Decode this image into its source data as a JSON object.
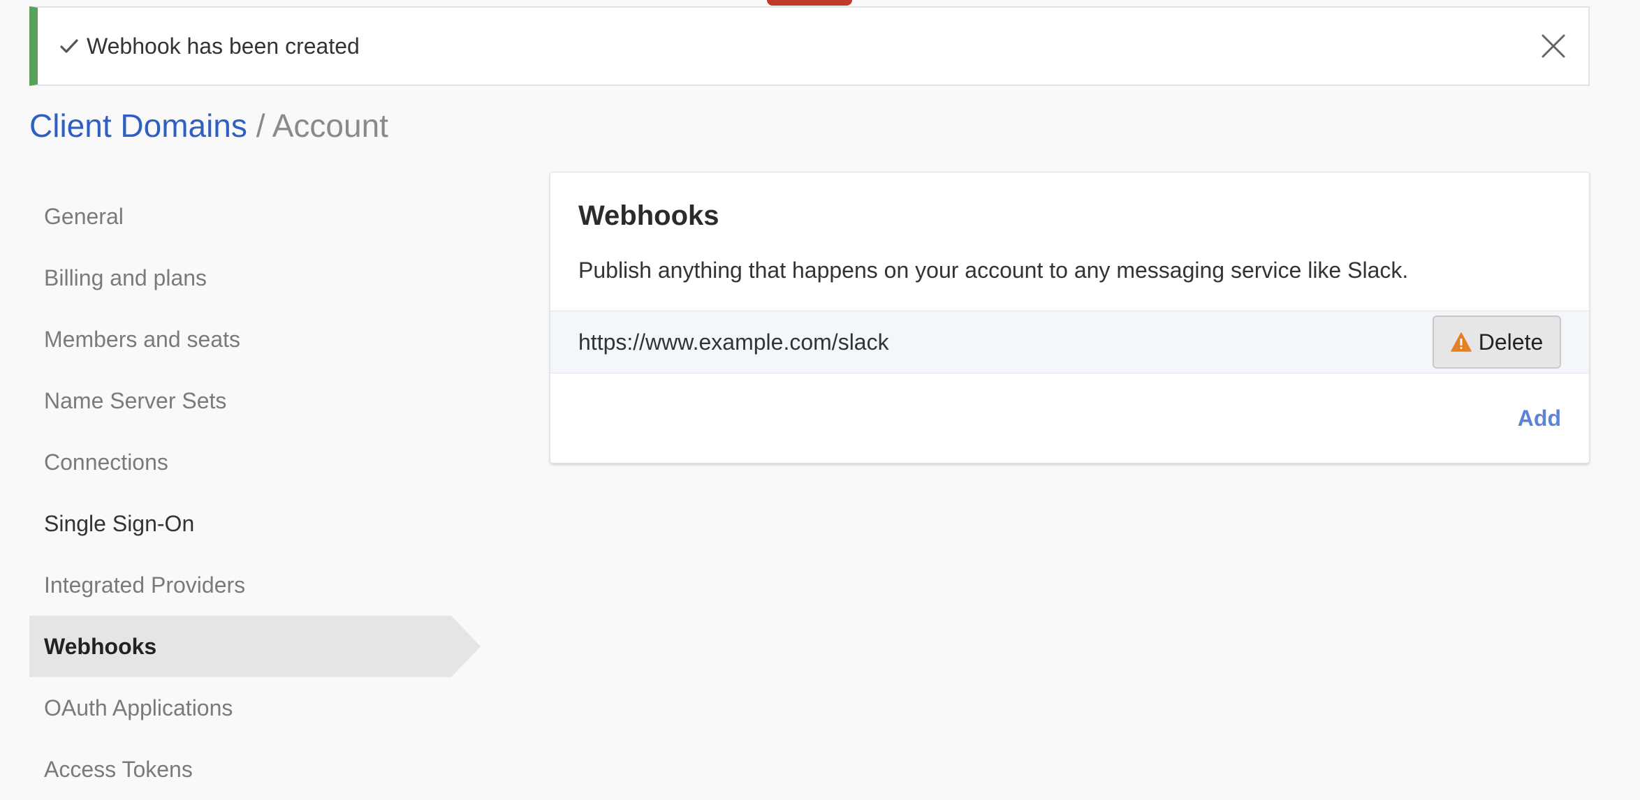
{
  "colors": {
    "success": "#5aa05a",
    "link": "#2f5fc2",
    "accent_link": "#5b84d6",
    "warning": "#e67e22",
    "top_tab": "#c0392b"
  },
  "alert": {
    "icon": "check-icon",
    "message": "Webhook has been created",
    "close_icon": "close-icon"
  },
  "breadcrumb": {
    "parent": "Client Domains",
    "separator": "/",
    "current": "Account"
  },
  "sidebar": {
    "items": [
      {
        "label": "General"
      },
      {
        "label": "Billing and plans"
      },
      {
        "label": "Members and seats"
      },
      {
        "label": "Name Server Sets"
      },
      {
        "label": "Connections"
      },
      {
        "label": "Single Sign-On"
      },
      {
        "label": "Integrated Providers"
      },
      {
        "label": "Webhooks",
        "active": true
      },
      {
        "label": "OAuth Applications"
      },
      {
        "label": "Access Tokens"
      }
    ]
  },
  "panel": {
    "title": "Webhooks",
    "description": "Publish anything that happens on your account to any messaging service like Slack.",
    "webhooks": [
      {
        "url": "https://www.example.com/slack",
        "delete_label": "Delete",
        "delete_icon": "warning-icon"
      }
    ],
    "add_label": "Add"
  }
}
